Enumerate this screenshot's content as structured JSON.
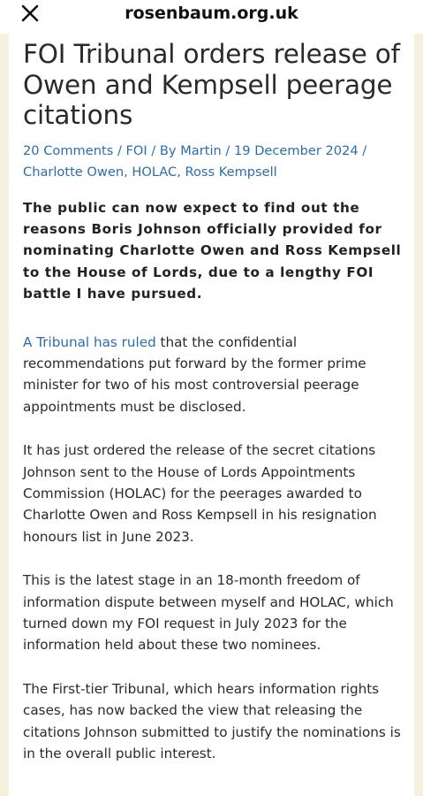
{
  "browser": {
    "url": "rosenbaum.org.uk",
    "close_icon": "close-icon"
  },
  "article": {
    "title": "FOI Tribunal orders release of Owen and Kempsell peerage citations",
    "meta": {
      "comments": "20 Comments",
      "category": "FOI",
      "by_prefix": "By",
      "author": "Martin",
      "date": "19 December 2024",
      "separator": " / ",
      "tags": [
        "Charlotte Owen",
        "HOLAC",
        "Ross Kempsell"
      ]
    },
    "lead": "The public can now expect to find out the reasons Boris Johnson officially provided for nominating Charlotte Owen and Ross Kempsell to the House of Lords, due to a lengthy FOI battle I have pursued.",
    "p1_link": "A Tribunal has ruled",
    "p1_rest": " that the confidential recommendations put forward by the former prime minister for two of his most controversial peerage appointments must be disclosed.",
    "p2": "It has just ordered the release of the secret citations Johnson sent to the House of Lords Appointments Commission (HOLAC) for the peerages awarded to Charlotte Owen and Ross Kempsell in his resignation honours list in June 2023.",
    "p3": "This is the latest stage in an 18-month freedom of information dispute between myself and HOLAC, which turned down my FOI request in July 2023 for the information held about these two nominees.",
    "p4": "The First-tier Tribunal, which hears information rights cases, has now backed the view that releasing the citations Johnson submitted to justify the nominations is in the overall public interest."
  }
}
